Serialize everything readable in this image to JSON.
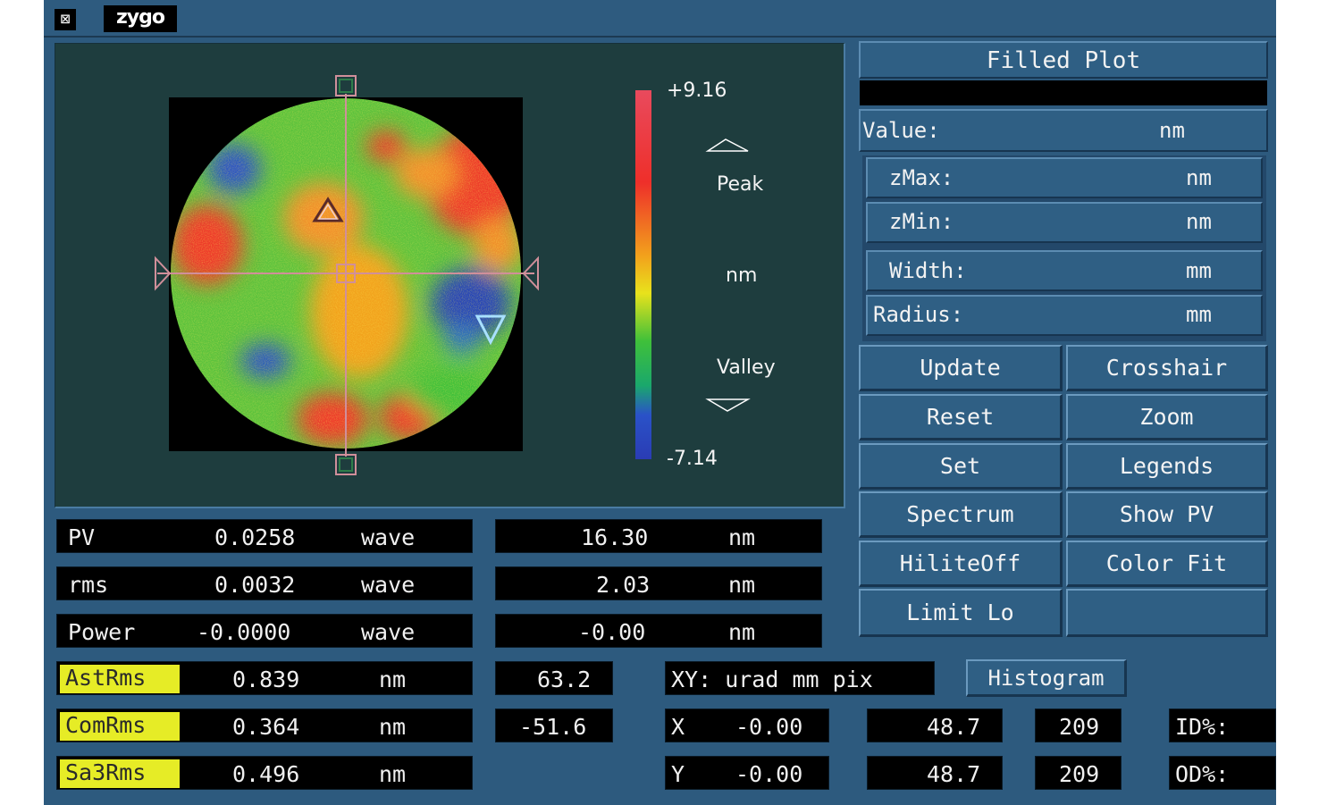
{
  "app": {
    "logo": "zygo",
    "system_menu_icon": "window-menu-icon"
  },
  "plot": {
    "title": "Filled Plot",
    "scale_max": "+9.16",
    "scale_min": "-7.14",
    "peak_label": "Peak",
    "unit_label": "nm",
    "valley_label": "Valley",
    "colors": {
      "high": "#e8384f",
      "mid": "#4ac23c",
      "low": "#2b44b8"
    }
  },
  "cursor_info": {
    "value_label": "Value:",
    "value_unit": "nm",
    "zmax_label": "zMax:",
    "zmax_unit": "nm",
    "zmin_label": "zMin:",
    "zmin_unit": "nm",
    "width_label": "Width:",
    "width_unit": "mm",
    "radius_label": "Radius:",
    "radius_unit": "mm"
  },
  "buttons": {
    "update": "Update",
    "crosshair": "Crosshair",
    "reset": "Reset",
    "zoom": "Zoom",
    "set": "Set",
    "legends": "Legends",
    "spectrum": "Spectrum",
    "show_pv": "Show PV",
    "hilite_off": "HiliteOff",
    "color_fit": "Color Fit",
    "limit_lo": "Limit Lo",
    "histogram": "Histogram"
  },
  "results": [
    {
      "name": "PV",
      "value": "0.0258",
      "unit": "wave",
      "nm_value": "16.30",
      "nm_unit": "nm"
    },
    {
      "name": "rms",
      "value": "0.0032",
      "unit": "wave",
      "nm_value": "2.03",
      "nm_unit": "nm"
    },
    {
      "name": "Power",
      "value": "-0.0000",
      "unit": "wave",
      "nm_value": "-0.00",
      "nm_unit": "nm"
    }
  ],
  "aberrations": [
    {
      "name": "AstRms",
      "value": "0.839",
      "unit": "nm",
      "angle": "63.2"
    },
    {
      "name": "ComRms",
      "value": "0.364",
      "unit": "nm",
      "angle": "-51.6"
    },
    {
      "name": "Sa3Rms",
      "value": "0.496",
      "unit": "nm"
    }
  ],
  "xy": {
    "units_label": "XY: urad mm pix",
    "x_label": "X",
    "x_urad": "-0.00",
    "x_mm": "48.7",
    "x_pix": "209",
    "y_label": "Y",
    "y_urad": "-0.00",
    "y_mm": "48.7",
    "y_pix": "209"
  },
  "id_label": "ID%:",
  "od_label": "OD%:"
}
